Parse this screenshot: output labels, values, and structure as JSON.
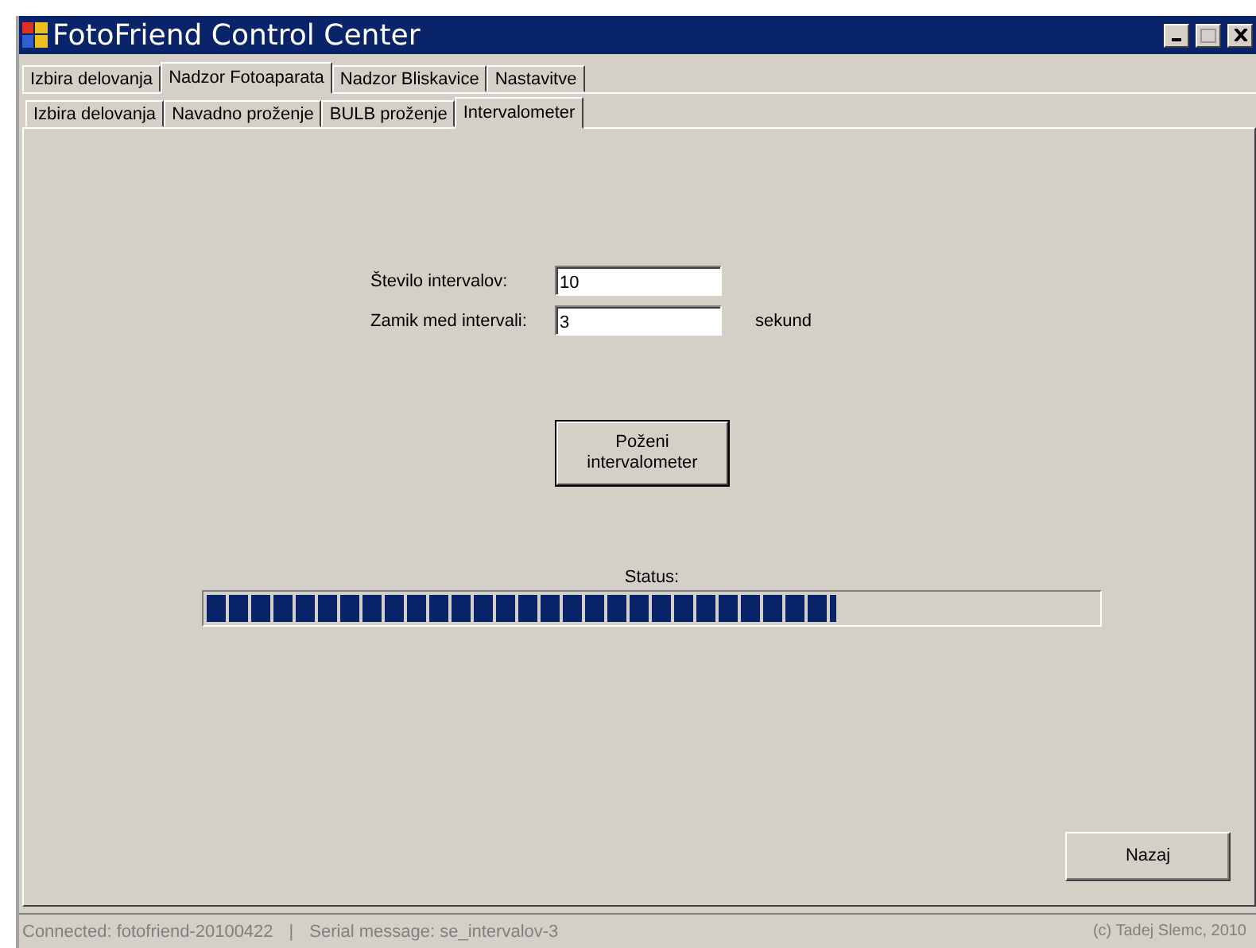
{
  "window": {
    "title": "FotoFriend Control Center"
  },
  "tabs": [
    {
      "label": "Izbira delovanja",
      "selected": false
    },
    {
      "label": "Nadzor Fotoaparata",
      "selected": true
    },
    {
      "label": "Nadzor Bliskavice",
      "selected": false
    },
    {
      "label": "Nastavitve",
      "selected": false
    }
  ],
  "subtabs": [
    {
      "label": "Izbira delovanja",
      "selected": false
    },
    {
      "label": "Navadno proženje",
      "selected": false
    },
    {
      "label": "BULB proženje",
      "selected": false
    },
    {
      "label": "Intervalometer",
      "selected": true
    }
  ],
  "fields": [
    {
      "label": "Število intervalov:",
      "value": "10"
    },
    {
      "label": "Zamik med intervali:",
      "value": "3",
      "unit": "sekund"
    }
  ],
  "start_button": {
    "line1": "Poženi",
    "line2": "intervalometer"
  },
  "status": {
    "label": "Status:",
    "level": 0.705
  },
  "back_button": "Nazaj",
  "status_bar": {
    "connected": "Connected: fotofriend-20100422",
    "separator": "|",
    "message": "Serial message: se_intervalov-3",
    "copyright": "(c) Tadej Slemc, 2010"
  }
}
